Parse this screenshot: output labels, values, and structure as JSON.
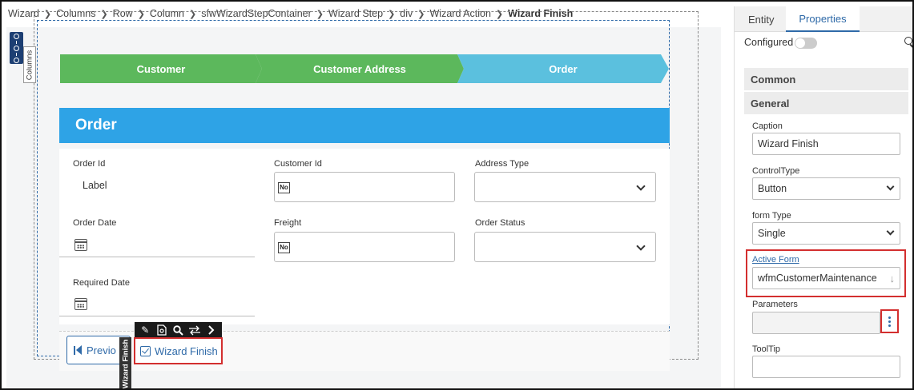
{
  "breadcrumb": [
    "Wizard",
    "Columns",
    "Row",
    "Column",
    "sfwWizardStepContainer",
    "Wizard Step",
    "div",
    "Wizard Action",
    "Wizard Finish"
  ],
  "canvas": {
    "columns_tag": "Columns",
    "steps": [
      "Customer",
      "Customer Address",
      "Order"
    ],
    "card_title": "Order",
    "fields": {
      "order_id": {
        "label": "Order Id",
        "value": "Label"
      },
      "customer_id": {
        "label": "Customer Id"
      },
      "address_type": {
        "label": "Address Type"
      },
      "order_date": {
        "label": "Order Date"
      },
      "freight": {
        "label": "Freight"
      },
      "order_status": {
        "label": "Order Status"
      },
      "required_date": {
        "label": "Required Date"
      }
    },
    "no_badge": "No",
    "prev_label": "Previo",
    "finish_tag": "Wizard Finish",
    "finish_label": "Wizard Finish",
    "toolbar_icons": [
      "pencil-icon",
      "document-gear-icon",
      "search-icon",
      "swap-arrows-icon",
      "chevron-right-icon"
    ]
  },
  "panel": {
    "tabs": [
      "Entity",
      "Properties"
    ],
    "configured_label": "Configured",
    "sections": [
      "Common",
      "General"
    ],
    "caption": {
      "label": "Caption",
      "value": "Wizard Finish"
    },
    "control_type": {
      "label": "ControlType",
      "value": "Button"
    },
    "form_type": {
      "label": "form Type",
      "value": "Single"
    },
    "active_form": {
      "label": "Active Form",
      "value": "wfmCustomerMaintenance"
    },
    "parameters": {
      "label": "Parameters",
      "value": ""
    },
    "tooltip": {
      "label": "ToolTip",
      "value": ""
    }
  },
  "colors": {
    "step_done": "#5cb85c",
    "step_active": "#5bc0de",
    "card_header": "#2ea3e6",
    "highlight": "#d32f2f",
    "accent": "#2f6aa8"
  }
}
